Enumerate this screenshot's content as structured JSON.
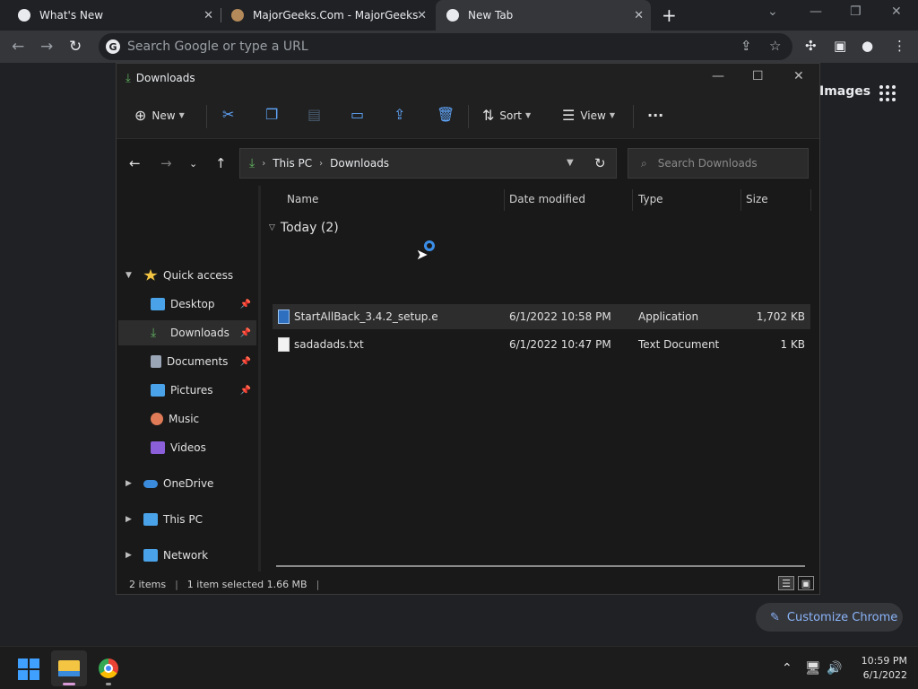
{
  "browser": {
    "tabs": [
      {
        "title": "What's New",
        "close": "✕"
      },
      {
        "title": "MajorGeeks.Com - MajorGeeks",
        "close": "✕"
      },
      {
        "title": "New Tab",
        "close": "✕"
      }
    ],
    "new_tab": "+",
    "omnibox_placeholder": "Search Google or type a URL",
    "page_link_images": "Images",
    "customize_label": "Customize Chrome"
  },
  "explorer": {
    "title": "Downloads",
    "commands": {
      "new": "New",
      "sort": "Sort",
      "view": "View",
      "more": "···"
    },
    "breadcrumb": [
      "This PC",
      "Downloads"
    ],
    "search_placeholder": "Search Downloads",
    "nav": [
      {
        "label": "Quick access",
        "color": "#f4c542"
      },
      {
        "label": "Desktop",
        "color": "#4aa3e8"
      },
      {
        "label": "Downloads",
        "color": "#5fb35f"
      },
      {
        "label": "Documents",
        "color": "#9aa5b5"
      },
      {
        "label": "Pictures",
        "color": "#4aa3e8"
      },
      {
        "label": "Music",
        "color": "#e07b57"
      },
      {
        "label": "Videos",
        "color": "#8a5fd9"
      },
      {
        "label": "OneDrive",
        "color": "#3a8bdc"
      },
      {
        "label": "This PC",
        "color": "#4aa3e8"
      },
      {
        "label": "Network",
        "color": "#4aa3e8"
      }
    ],
    "columns": [
      "Name",
      "Date modified",
      "Type",
      "Size"
    ],
    "group": "Today (2)",
    "files": [
      {
        "name": "StartAllBack_3.4.2_setup.e",
        "date": "6/1/2022 10:58 PM",
        "type": "Application",
        "size": "1,702 KB"
      },
      {
        "name": "sadadads.txt",
        "date": "6/1/2022 10:47 PM",
        "type": "Text Document",
        "size": "1 KB"
      }
    ],
    "status": {
      "items": "2 items",
      "selected": "1 item selected  1.66 MB"
    }
  },
  "taskbar": {
    "time": "10:59 PM",
    "date": "6/1/2022"
  }
}
